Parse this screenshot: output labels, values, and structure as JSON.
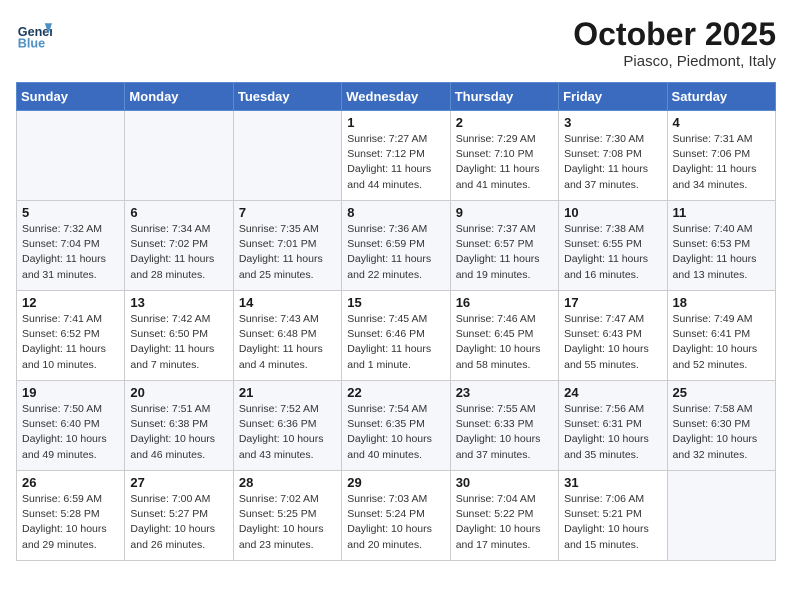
{
  "header": {
    "logo_line1": "General",
    "logo_line2": "Blue",
    "month_title": "October 2025",
    "location": "Piasco, Piedmont, Italy"
  },
  "weekdays": [
    "Sunday",
    "Monday",
    "Tuesday",
    "Wednesday",
    "Thursday",
    "Friday",
    "Saturday"
  ],
  "weeks": [
    [
      {
        "day": "",
        "info": ""
      },
      {
        "day": "",
        "info": ""
      },
      {
        "day": "",
        "info": ""
      },
      {
        "day": "1",
        "info": "Sunrise: 7:27 AM\nSunset: 7:12 PM\nDaylight: 11 hours\nand 44 minutes."
      },
      {
        "day": "2",
        "info": "Sunrise: 7:29 AM\nSunset: 7:10 PM\nDaylight: 11 hours\nand 41 minutes."
      },
      {
        "day": "3",
        "info": "Sunrise: 7:30 AM\nSunset: 7:08 PM\nDaylight: 11 hours\nand 37 minutes."
      },
      {
        "day": "4",
        "info": "Sunrise: 7:31 AM\nSunset: 7:06 PM\nDaylight: 11 hours\nand 34 minutes."
      }
    ],
    [
      {
        "day": "5",
        "info": "Sunrise: 7:32 AM\nSunset: 7:04 PM\nDaylight: 11 hours\nand 31 minutes."
      },
      {
        "day": "6",
        "info": "Sunrise: 7:34 AM\nSunset: 7:02 PM\nDaylight: 11 hours\nand 28 minutes."
      },
      {
        "day": "7",
        "info": "Sunrise: 7:35 AM\nSunset: 7:01 PM\nDaylight: 11 hours\nand 25 minutes."
      },
      {
        "day": "8",
        "info": "Sunrise: 7:36 AM\nSunset: 6:59 PM\nDaylight: 11 hours\nand 22 minutes."
      },
      {
        "day": "9",
        "info": "Sunrise: 7:37 AM\nSunset: 6:57 PM\nDaylight: 11 hours\nand 19 minutes."
      },
      {
        "day": "10",
        "info": "Sunrise: 7:38 AM\nSunset: 6:55 PM\nDaylight: 11 hours\nand 16 minutes."
      },
      {
        "day": "11",
        "info": "Sunrise: 7:40 AM\nSunset: 6:53 PM\nDaylight: 11 hours\nand 13 minutes."
      }
    ],
    [
      {
        "day": "12",
        "info": "Sunrise: 7:41 AM\nSunset: 6:52 PM\nDaylight: 11 hours\nand 10 minutes."
      },
      {
        "day": "13",
        "info": "Sunrise: 7:42 AM\nSunset: 6:50 PM\nDaylight: 11 hours\nand 7 minutes."
      },
      {
        "day": "14",
        "info": "Sunrise: 7:43 AM\nSunset: 6:48 PM\nDaylight: 11 hours\nand 4 minutes."
      },
      {
        "day": "15",
        "info": "Sunrise: 7:45 AM\nSunset: 6:46 PM\nDaylight: 11 hours\nand 1 minute."
      },
      {
        "day": "16",
        "info": "Sunrise: 7:46 AM\nSunset: 6:45 PM\nDaylight: 10 hours\nand 58 minutes."
      },
      {
        "day": "17",
        "info": "Sunrise: 7:47 AM\nSunset: 6:43 PM\nDaylight: 10 hours\nand 55 minutes."
      },
      {
        "day": "18",
        "info": "Sunrise: 7:49 AM\nSunset: 6:41 PM\nDaylight: 10 hours\nand 52 minutes."
      }
    ],
    [
      {
        "day": "19",
        "info": "Sunrise: 7:50 AM\nSunset: 6:40 PM\nDaylight: 10 hours\nand 49 minutes."
      },
      {
        "day": "20",
        "info": "Sunrise: 7:51 AM\nSunset: 6:38 PM\nDaylight: 10 hours\nand 46 minutes."
      },
      {
        "day": "21",
        "info": "Sunrise: 7:52 AM\nSunset: 6:36 PM\nDaylight: 10 hours\nand 43 minutes."
      },
      {
        "day": "22",
        "info": "Sunrise: 7:54 AM\nSunset: 6:35 PM\nDaylight: 10 hours\nand 40 minutes."
      },
      {
        "day": "23",
        "info": "Sunrise: 7:55 AM\nSunset: 6:33 PM\nDaylight: 10 hours\nand 37 minutes."
      },
      {
        "day": "24",
        "info": "Sunrise: 7:56 AM\nSunset: 6:31 PM\nDaylight: 10 hours\nand 35 minutes."
      },
      {
        "day": "25",
        "info": "Sunrise: 7:58 AM\nSunset: 6:30 PM\nDaylight: 10 hours\nand 32 minutes."
      }
    ],
    [
      {
        "day": "26",
        "info": "Sunrise: 6:59 AM\nSunset: 5:28 PM\nDaylight: 10 hours\nand 29 minutes."
      },
      {
        "day": "27",
        "info": "Sunrise: 7:00 AM\nSunset: 5:27 PM\nDaylight: 10 hours\nand 26 minutes."
      },
      {
        "day": "28",
        "info": "Sunrise: 7:02 AM\nSunset: 5:25 PM\nDaylight: 10 hours\nand 23 minutes."
      },
      {
        "day": "29",
        "info": "Sunrise: 7:03 AM\nSunset: 5:24 PM\nDaylight: 10 hours\nand 20 minutes."
      },
      {
        "day": "30",
        "info": "Sunrise: 7:04 AM\nSunset: 5:22 PM\nDaylight: 10 hours\nand 17 minutes."
      },
      {
        "day": "31",
        "info": "Sunrise: 7:06 AM\nSunset: 5:21 PM\nDaylight: 10 hours\nand 15 minutes."
      },
      {
        "day": "",
        "info": ""
      }
    ]
  ]
}
